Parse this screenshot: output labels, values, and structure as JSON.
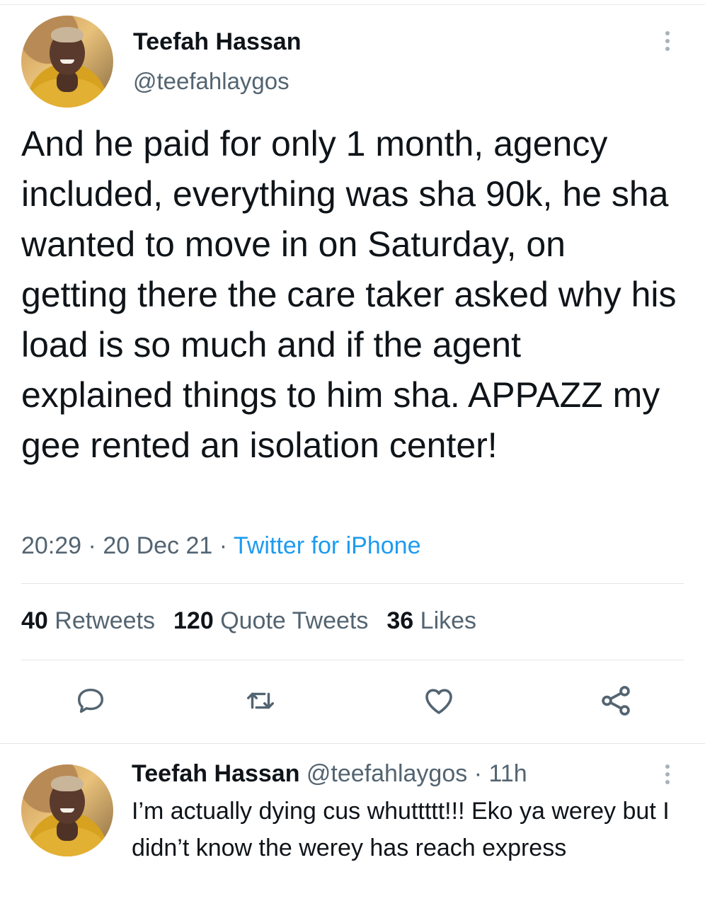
{
  "tweet": {
    "author_name": "Teefah Hassan",
    "author_handle": "@teefahlaygos",
    "text": "And he paid for only 1 month, agency included, everything was sha 90k, he sha wanted to move in on Saturday, on getting there the care taker asked why his load is so much and if the agent explained things to him sha. APPAZZ my gee rented an isolation center!",
    "time": "20:29",
    "date": "20 Dec 21",
    "separator": " · ",
    "source": "Twitter for iPhone"
  },
  "stats": {
    "retweets_count": "40",
    "retweets_label": "Retweets",
    "quotes_count": "120",
    "quotes_label": "Quote Tweets",
    "likes_count": "36",
    "likes_label": "Likes"
  },
  "actions": {
    "icons": [
      "reply-icon",
      "retweet-icon",
      "like-icon",
      "share-icon"
    ],
    "icon_color": "#536471"
  },
  "reply": {
    "author_name": "Teefah Hassan",
    "author_handle": "@teefahlaygos",
    "separator": " · ",
    "time_ago": "11h",
    "text": "I’m actually dying cus whuttttt!!! Eko ya werey but I didn’t know the werey has reach express"
  },
  "colors": {
    "text_primary": "#0f1419",
    "text_secondary": "#536471",
    "link": "#1d9bf0",
    "divider": "#e1e5e8"
  }
}
